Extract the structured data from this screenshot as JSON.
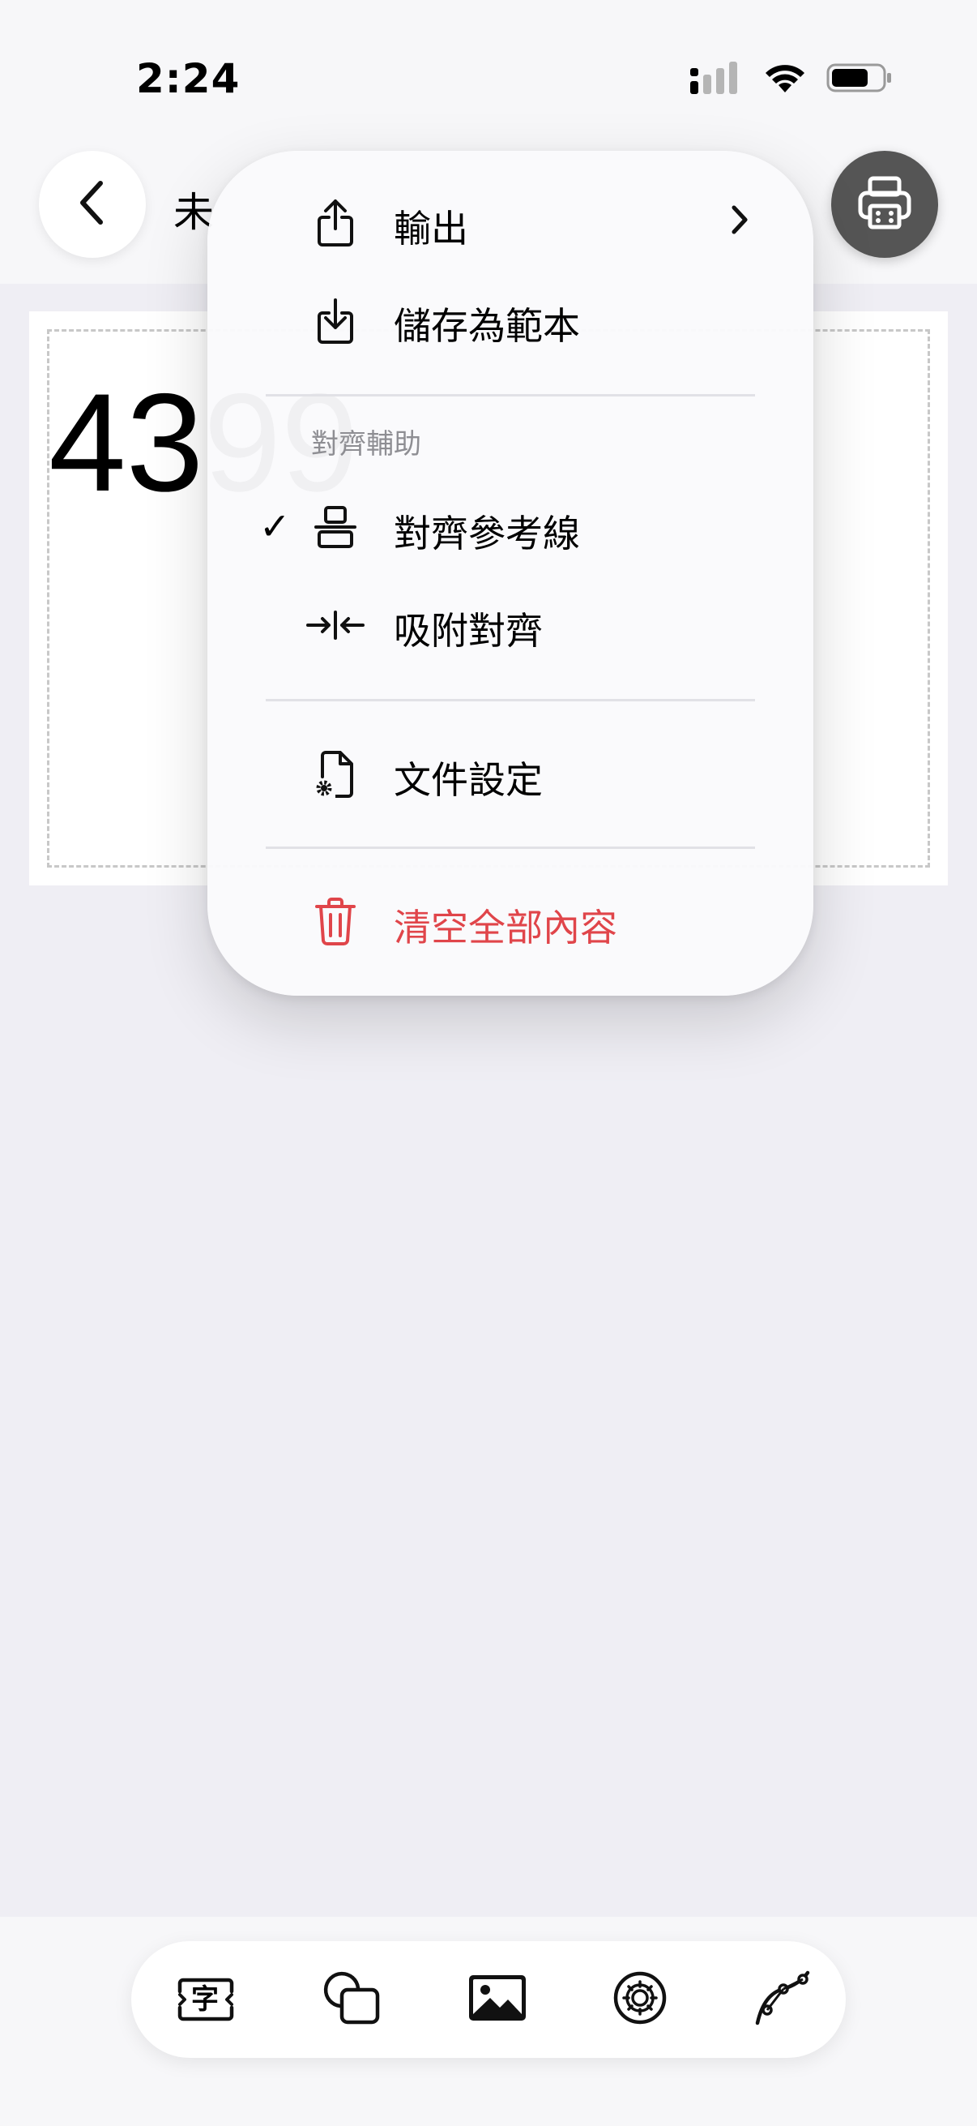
{
  "status_bar": {
    "time": "2:24",
    "icons": [
      "signal-icon",
      "wifi-icon",
      "battery-icon"
    ]
  },
  "nav": {
    "title": "未",
    "back_icon": "chevron-left-icon",
    "print_icon": "printer-icon"
  },
  "canvas": {
    "text": "4399"
  },
  "menu": {
    "items": [
      {
        "label": "輸出",
        "icon": "share-icon",
        "has_submenu": true
      },
      {
        "label": "儲存為範本",
        "icon": "download-icon"
      }
    ],
    "alignment_section": {
      "header": "對齊輔助",
      "items": [
        {
          "label": "對齊參考線",
          "icon": "align-guides-icon",
          "checked": true
        },
        {
          "label": "吸附對齊",
          "icon": "snap-align-icon",
          "checked": false
        }
      ]
    },
    "document_settings": {
      "label": "文件設定",
      "icon": "document-gear-icon"
    },
    "clear_all": {
      "label": "清空全部內容",
      "icon": "trash-icon",
      "color": "#e0454a"
    },
    "check_mark": "✓"
  },
  "toolbar": {
    "tools": [
      "text-tool-icon",
      "shape-tool-icon",
      "image-tool-icon",
      "symbol-tool-icon",
      "pen-tool-icon"
    ],
    "text_tool_glyph": "字"
  }
}
